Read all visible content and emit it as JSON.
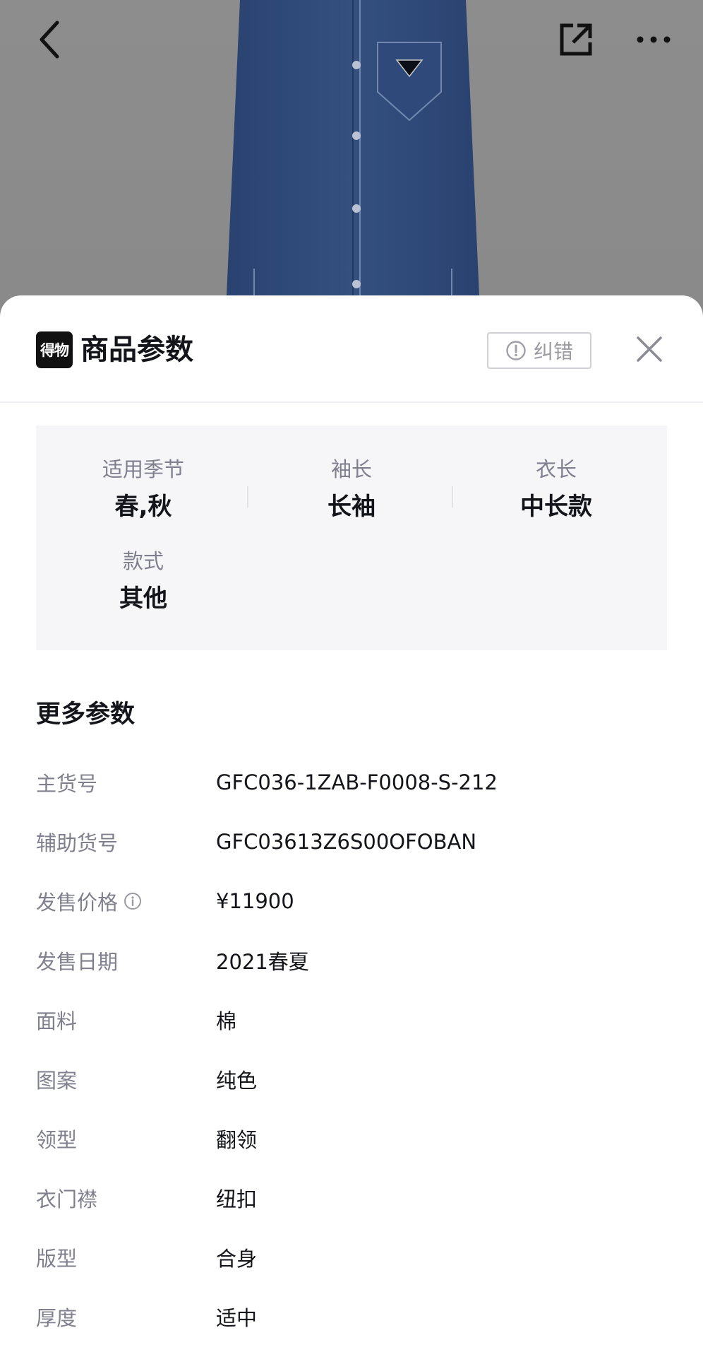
{
  "topbar": {
    "back_icon": "chevron-left-icon",
    "share_icon": "share-external-icon",
    "more_icon": "more-horizontal-icon"
  },
  "sheet": {
    "logo_text": "得物",
    "title": "商品参数",
    "report_label": "纠错",
    "report_icon": "alert-circle-icon",
    "close_icon": "close-icon"
  },
  "key_attributes": [
    {
      "label": "适用季节",
      "value": "春,秋"
    },
    {
      "label": "袖长",
      "value": "长袖"
    },
    {
      "label": "衣长",
      "value": "中长款"
    },
    {
      "label": "款式",
      "value": "其他"
    }
  ],
  "more_params": {
    "title": "更多参数",
    "rows": [
      {
        "label": "主货号",
        "value": "GFC036-1ZAB-F0008-S-212"
      },
      {
        "label": "辅助货号",
        "value": "GFC03613Z6S00OFOBAN"
      },
      {
        "label": "发售价格",
        "value": "¥11900",
        "info_icon": "info-icon"
      },
      {
        "label": "发售日期",
        "value": "2021春夏"
      },
      {
        "label": "面料",
        "value": "棉"
      },
      {
        "label": "图案",
        "value": "纯色"
      },
      {
        "label": "领型",
        "value": "翻领"
      },
      {
        "label": "衣门襟",
        "value": "纽扣"
      },
      {
        "label": "版型",
        "value": "合身"
      },
      {
        "label": "厚度",
        "value": "适中"
      }
    ]
  },
  "colors": {
    "background_overlay": "#888888",
    "denim": "#2e4a78",
    "text_primary": "#14151a",
    "text_secondary": "#7f7f8e",
    "card_bg": "#f6f6f9"
  }
}
